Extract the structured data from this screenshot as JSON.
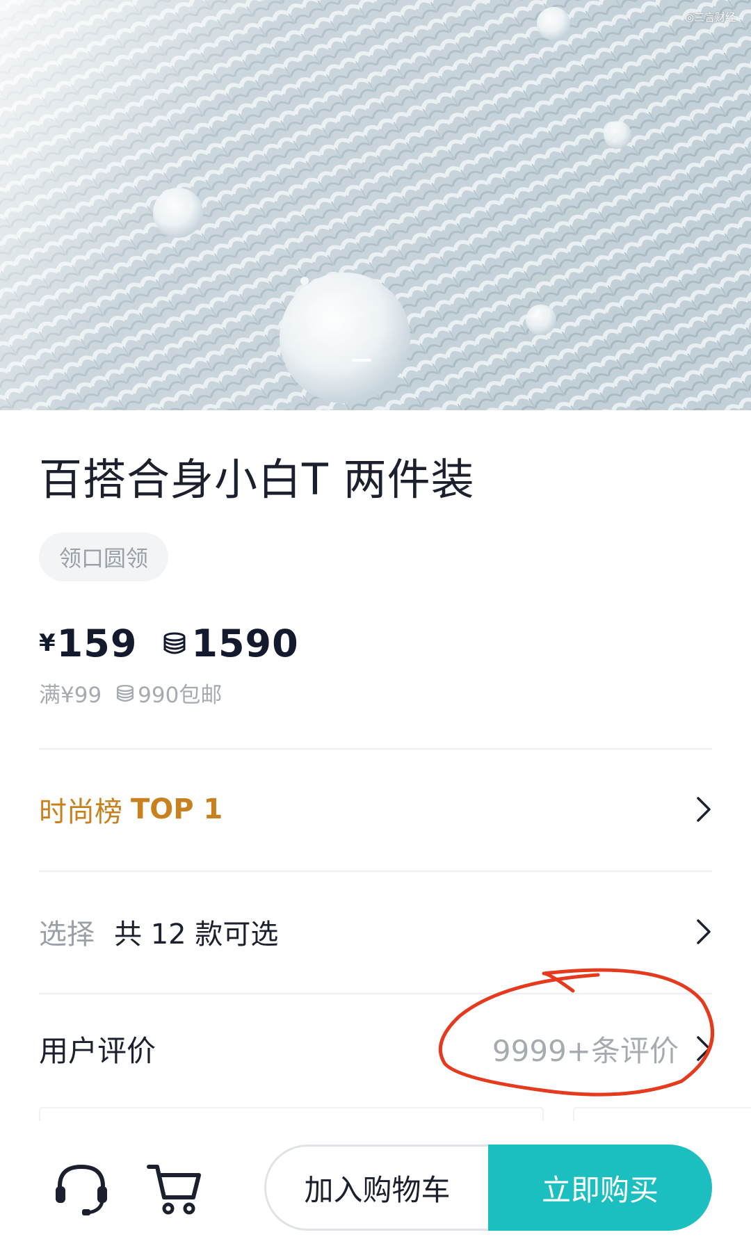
{
  "hero": {
    "watermark": "◎三言财经"
  },
  "product": {
    "title": "百搭合身小白T 两件装",
    "tag": "领口圆领",
    "price_symbol": "¥",
    "price": "159",
    "coin_price": "1590",
    "shipping_prefix": "满¥99",
    "shipping_suffix": "990包邮"
  },
  "ranking": {
    "label": "时尚榜",
    "value": "TOP 1"
  },
  "selection": {
    "label": "选择",
    "value": "共 12 款可选"
  },
  "reviews": {
    "label": "用户评价",
    "count": "9999+条评价"
  },
  "bottom_bar": {
    "add_to_cart": "加入购物车",
    "buy_now": "立即购买"
  },
  "colors": {
    "accent": "#1cbfbf",
    "ranking": "#c8811e",
    "annotation": "#e53a1e"
  }
}
